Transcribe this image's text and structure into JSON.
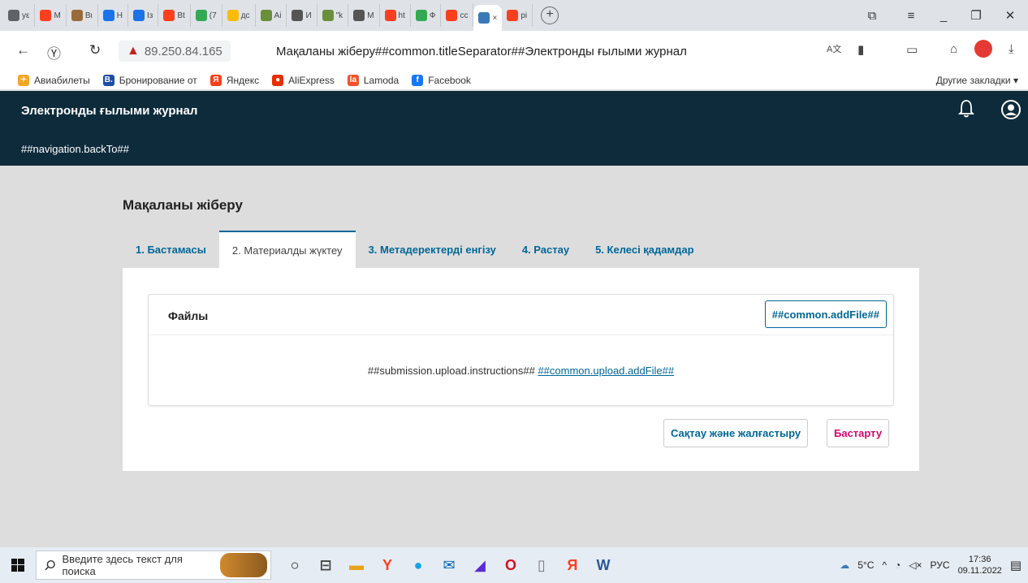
{
  "browser": {
    "tabs": [
      {
        "label": "yε",
        "color": "#5f6368"
      },
      {
        "label": "M",
        "color": "#fc3f1d"
      },
      {
        "label": "Bι",
        "color": "#9a6b3a"
      },
      {
        "label": "H",
        "color": "#1a73e8"
      },
      {
        "label": "Iз",
        "color": "#1a73e8"
      },
      {
        "label": "Bt",
        "color": "#fc3f1d"
      },
      {
        "label": "(7",
        "color": "#34a853"
      },
      {
        "label": "дс",
        "color": "#fbbc04"
      },
      {
        "label": "Ai",
        "color": "#6a8f3a"
      },
      {
        "label": "И",
        "color": "#555"
      },
      {
        "label": "\"k",
        "color": "#6a8f3a"
      },
      {
        "label": "M",
        "color": "#555"
      },
      {
        "label": "ht",
        "color": "#fc3f1d"
      },
      {
        "label": "Ф",
        "color": "#34a853"
      },
      {
        "label": "cc",
        "color": "#fc3f1d"
      }
    ],
    "active_tab": {
      "label": "×",
      "color": "#3b79b6"
    },
    "after_tab": {
      "label": "pi",
      "color": "#fc3f1d"
    },
    "new_tab": "+",
    "window_controls": {
      "collections": "⧉",
      "menu": "≡",
      "minimize": "_",
      "restore": "❐",
      "close": "✕"
    },
    "address": {
      "ip": "89.250.84.165",
      "title": "Мақаланы жіберу##common.titleSeparator##Электронды ғылыми журнал",
      "back": "←",
      "yandex": "Ⓨ",
      "refresh": "↻",
      "warning": "▲",
      "translate": "A文",
      "bookmark": "▮",
      "battery": "▭",
      "ext": "⌂",
      "download": "⤓"
    },
    "bookmarks": [
      {
        "label": "Авиабилеты",
        "color": "#f5a623",
        "glyph": "✈"
      },
      {
        "label": "Бронирование от",
        "color": "#1d4ea1",
        "glyph": "B."
      },
      {
        "label": "Яндекс",
        "color": "#fc3f1d",
        "glyph": "Я"
      },
      {
        "label": "AliExpress",
        "color": "#e62e04",
        "glyph": "●"
      },
      {
        "label": "Lamoda",
        "color": "#f0522b",
        "glyph": "la"
      },
      {
        "label": "Facebook",
        "color": "#1877f2",
        "glyph": "f"
      }
    ],
    "other_bookmarks": "Другие закладки ▾"
  },
  "site": {
    "title": "Электронды ғылыми журнал",
    "back_link": "##navigation.backTo##"
  },
  "page": {
    "title": "Мақаланы жіберу",
    "steps": [
      "1. Бастамасы",
      "2. Материалды жүктеу",
      "3. Метадеректерді енгізу",
      "4. Растау",
      "5. Келесі қадамдар"
    ],
    "active_step": 1,
    "files_title": "Файлы",
    "add_file_button": "##common.addFile##",
    "upload_instructions": "##submission.upload.instructions##",
    "upload_add_file_link": "##common.upload.addFile##",
    "save_button": "Сақтау және жалғастыру",
    "cancel_button": "Бастарту",
    "accent_color": "#006798",
    "header_color": "#0e2b3c"
  },
  "taskbar": {
    "search_placeholder": "Введите здесь текст для поиска",
    "apps": [
      {
        "glyph": "○",
        "color": "#222"
      },
      {
        "glyph": "⊟",
        "color": "#444"
      },
      {
        "glyph": "▬",
        "color": "#e8a317"
      },
      {
        "glyph": "Y",
        "color": "#fc3f1d"
      },
      {
        "glyph": "●",
        "color": "#1ba1e2"
      },
      {
        "glyph": "✉",
        "color": "#0063b1"
      },
      {
        "glyph": "◢",
        "color": "#5b2bd6"
      },
      {
        "glyph": "O",
        "color": "#d4111e"
      },
      {
        "glyph": "▯",
        "color": "#777"
      },
      {
        "glyph": "Я",
        "color": "#fc3f1d"
      },
      {
        "glyph": "W",
        "color": "#2b579a"
      }
    ],
    "weather": "5°C",
    "language": "РУС",
    "time": "17:36",
    "date": "09.11.2022"
  }
}
